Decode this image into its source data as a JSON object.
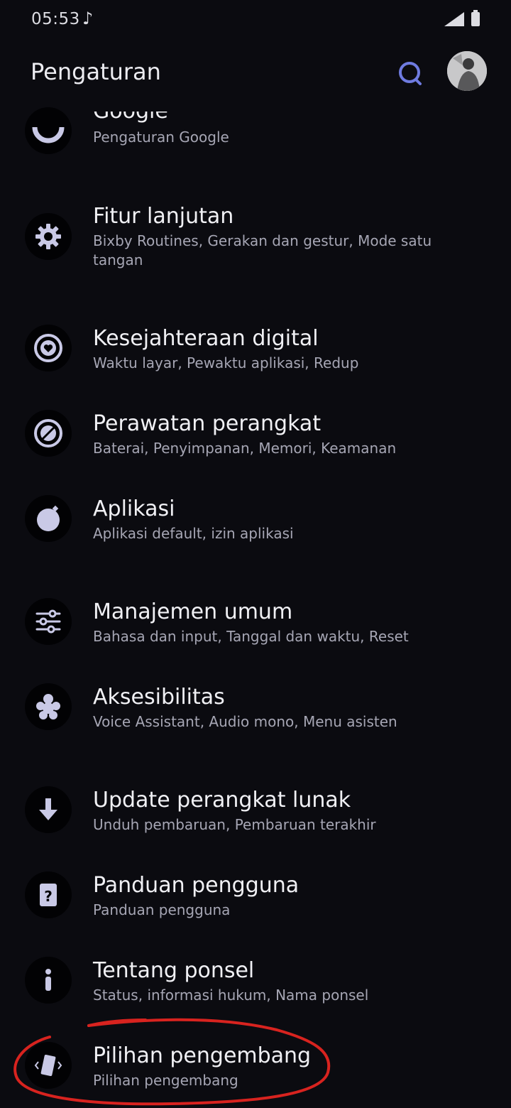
{
  "status": {
    "time": "05:53",
    "note_glyph": "♪"
  },
  "header": {
    "title": "Pengaturan"
  },
  "items": [
    {
      "title": "Google",
      "subtitle": "Pengaturan Google",
      "icon": "google-icon"
    },
    {
      "title": "Fitur lanjutan",
      "subtitle": "Bixby Routines, Gerakan dan gestur, Mode satu tangan",
      "icon": "gear-icon"
    },
    {
      "title": "Kesejahteraan digital",
      "subtitle": "Waktu layar, Pewaktu aplikasi, Redup",
      "icon": "heart-target-icon"
    },
    {
      "title": "Perawatan perangkat",
      "subtitle": "Baterai, Penyimpanan, Memori, Keamanan",
      "icon": "device-care-icon"
    },
    {
      "title": "Aplikasi",
      "subtitle": "Aplikasi default, izin aplikasi",
      "icon": "apps-icon"
    },
    {
      "title": "Manajemen umum",
      "subtitle": "Bahasa dan input, Tanggal dan waktu, Reset",
      "icon": "sliders-icon"
    },
    {
      "title": "Aksesibilitas",
      "subtitle": "Voice Assistant, Audio mono, Menu asisten",
      "icon": "accessibility-icon"
    },
    {
      "title": "Update perangkat lunak",
      "subtitle": "Unduh pembaruan, Pembaruan terakhir",
      "icon": "download-icon"
    },
    {
      "title": "Panduan pengguna",
      "subtitle": "Panduan pengguna",
      "icon": "help-icon"
    },
    {
      "title": "Tentang ponsel",
      "subtitle": "Status, informasi hukum, Nama ponsel",
      "icon": "info-icon"
    },
    {
      "title": "Pilihan pengembang",
      "subtitle": "Pilihan pengembang",
      "icon": "developer-icon"
    }
  ],
  "colors": {
    "background": "#0b0b10",
    "icon_fill": "#c9c9e6",
    "accent_search": "#6f7be0",
    "annotation": "#d8231f"
  }
}
